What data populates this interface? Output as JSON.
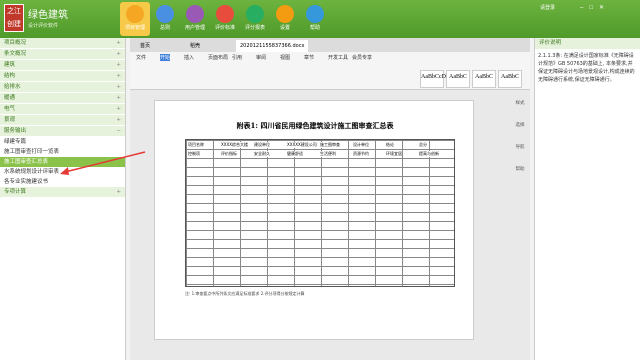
{
  "brand": {
    "name": "绿色建筑",
    "sub": "设计评价软件",
    "logo": [
      "之江",
      "创建"
    ]
  },
  "toolbar": [
    {
      "label": "项目管理",
      "color": "#f5a623"
    },
    {
      "label": "总则",
      "color": "#4a90e2"
    },
    {
      "label": "用户管理",
      "color": "#9b59b6"
    },
    {
      "label": "评价标准",
      "color": "#e74c3c"
    },
    {
      "label": "评分报表",
      "color": "#27ae60"
    },
    {
      "label": "设置",
      "color": "#f39c12"
    },
    {
      "label": "帮助",
      "color": "#3498db"
    }
  ],
  "user": "请登录",
  "sidebar": {
    "sections": [
      "项目概况",
      "条文概况",
      "建筑",
      "结构",
      "给排水",
      "暖通",
      "电气",
      "景观"
    ],
    "service": "服务输出",
    "items": [
      "绿建专篇",
      "施工图审查打印一览表",
      "施工图审查汇总表",
      "水系统规划设计评审表",
      "各专业实施建议书"
    ],
    "selected": 2,
    "last": "专项计算"
  },
  "doc": {
    "tabs": [
      "首页",
      "稻壳",
      "2020121155837366.docx"
    ],
    "menu": [
      "文件",
      "开始",
      "插入",
      "页面布局",
      "引用",
      "审阅",
      "视图",
      "章节",
      "开发工具",
      "会员专享"
    ],
    "styles": [
      "AaBbCcDd",
      "AaBbC",
      "AaBbC",
      "AaBbC"
    ],
    "title": "附表1: 四川省民用绿色建筑设计施工图审查汇总表",
    "cells": [
      "项目名称",
      "XXXX综合大楼",
      "建设单位",
      "XXXXX建设公司",
      "施工图审查",
      "设计单位",
      "结论",
      "总分",
      "控制项",
      "评价指标",
      "安全耐久",
      "健康舒适",
      "生活便利",
      "资源节约",
      "环境宜居",
      "提高与创新"
    ],
    "notes": "注: 1.审查要点中所列条文应满足标准要求 2.评分项得分按规定计算"
  },
  "rightTools": [
    "样式",
    "选择",
    "导航",
    "帮助"
  ],
  "rightPanel": {
    "title": "评价说明",
    "body": "2.1.1.3条: 在满足设计国家标准《无障碍设计规范》GB 50763的基础上, 本条要求,并保证无障碍设计与场地景观设计,构成连续的无障碍通行系统,保证无障碍通行。"
  }
}
